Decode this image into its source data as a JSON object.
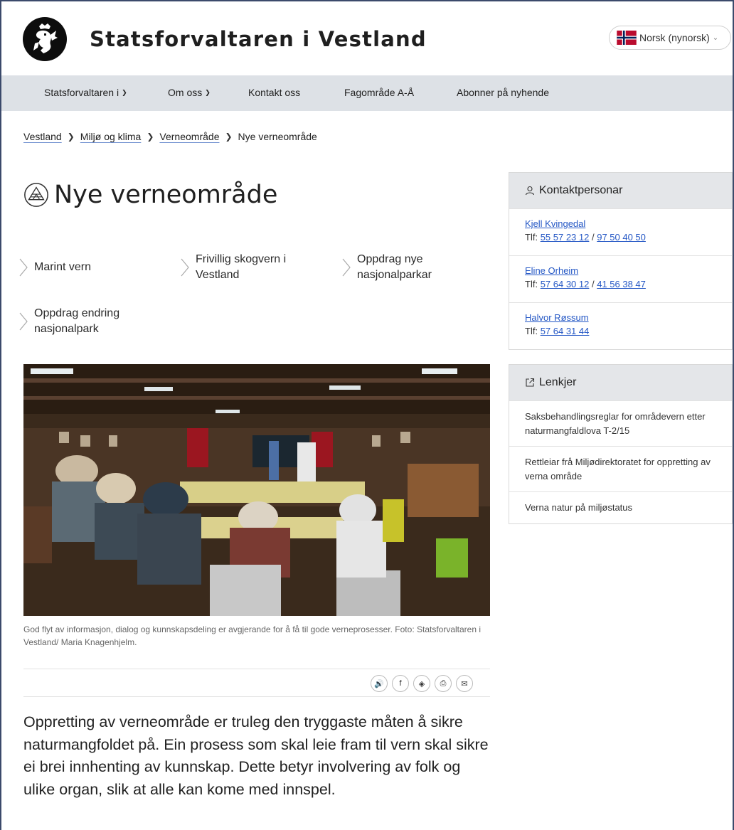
{
  "header": {
    "site_title": "Statsforvaltaren i Vestland",
    "language_label": "Norsk (nynorsk)"
  },
  "nav": {
    "items": [
      {
        "label": "Statsforvaltaren i",
        "has_dropdown": true
      },
      {
        "label": "Om oss",
        "has_dropdown": true
      },
      {
        "label": "Kontakt oss",
        "has_dropdown": false
      },
      {
        "label": "Fagområde A-Å",
        "has_dropdown": false
      },
      {
        "label": "Abonner på nyhende",
        "has_dropdown": false
      }
    ]
  },
  "breadcrumb": {
    "items": [
      "Vestland",
      "Miljø og klima",
      "Verneområde"
    ],
    "current": "Nye verneområde"
  },
  "page": {
    "title": "Nye verneområde",
    "title_icon": "protected-area-icon"
  },
  "quick_links": [
    "Marint vern",
    "Frivillig skogvern i Vestland",
    "Oppdrag nye nasjonalparkar",
    "Oppdrag endring nasjonalpark"
  ],
  "image": {
    "caption": "God flyt av informasjon, dialog og kunnskapsdeling er avgjerande for å få til gode verneprosesser. Foto: Statsforvaltaren i Vestland/ Maria Knagenhjelm."
  },
  "share": {
    "buttons": [
      "listen-icon",
      "facebook-icon",
      "twitter-icon",
      "print-icon",
      "email-icon"
    ]
  },
  "lead": "Oppretting av verneområde er truleg den tryggaste måten å sikre naturmangfoldet på. Ein prosess som skal leie fram til vern skal sikre ei brei innhenting av kunnskap. Dette betyr involvering av folk og ulike organ, slik at alle kan kome med innspel.",
  "contacts": {
    "heading": "Kontaktpersonar",
    "tlf_label": "Tlf:",
    "people": [
      {
        "name": "Kjell Kvingedal",
        "phones": [
          "55 57 23 12",
          "97 50 40 50"
        ]
      },
      {
        "name": "Eline Orheim",
        "phones": [
          "57 64 30 12",
          "41 56 38 47"
        ]
      },
      {
        "name": "Halvor Røssum",
        "phones": [
          "57 64 31 44"
        ]
      }
    ]
  },
  "links": {
    "heading": "Lenkjer",
    "items": [
      "Saksbehandlingsreglar for områdevern etter naturmangfaldlova T-2/15",
      "Rettleiar frå Miljødirektoratet for oppretting av verna område",
      "Verna natur på miljøstatus"
    ]
  },
  "colors": {
    "nav_bg": "#dde1e6",
    "link": "#2457c5",
    "box_head_bg": "#e4e6e9"
  }
}
